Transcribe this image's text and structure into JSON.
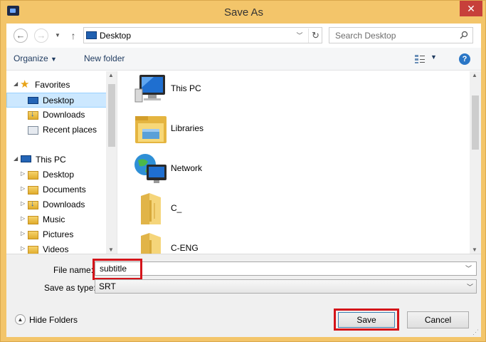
{
  "window": {
    "title": "Save As",
    "close_glyph": "✕"
  },
  "address": {
    "location": "Desktop",
    "search_placeholder": "Search Desktop"
  },
  "toolbar": {
    "organize_label": "Organize",
    "new_folder_label": "New folder",
    "help_glyph": "?"
  },
  "nav": {
    "favorites": {
      "label": "Favorites",
      "items": [
        {
          "label": "Desktop",
          "icon": "desktop-icon",
          "selected": true
        },
        {
          "label": "Downloads",
          "icon": "downloads-icon"
        },
        {
          "label": "Recent places",
          "icon": "recent-places-icon"
        }
      ]
    },
    "this_pc": {
      "label": "This PC",
      "items": [
        {
          "label": "Desktop",
          "icon": "desktop-icon"
        },
        {
          "label": "Documents",
          "icon": "documents-icon"
        },
        {
          "label": "Downloads",
          "icon": "downloads-icon"
        },
        {
          "label": "Music",
          "icon": "music-icon"
        },
        {
          "label": "Pictures",
          "icon": "pictures-icon"
        },
        {
          "label": "Videos",
          "icon": "videos-icon"
        }
      ]
    }
  },
  "content": {
    "items": [
      {
        "label": "This PC",
        "icon": "this-pc-icon"
      },
      {
        "label": "Libraries",
        "icon": "libraries-icon"
      },
      {
        "label": "Network",
        "icon": "network-icon"
      },
      {
        "label": "C_",
        "icon": "folder-icon"
      },
      {
        "label": "C-ENG",
        "icon": "folder-icon"
      }
    ]
  },
  "form": {
    "file_name_label": "File name:",
    "file_name_value": "subtitle",
    "save_type_label": "Save as type:",
    "save_type_value": "SRT"
  },
  "footer": {
    "hide_folders_label": "Hide Folders",
    "save_label": "Save",
    "cancel_label": "Cancel"
  },
  "colors": {
    "window_frame": "#f3c56a",
    "close_button": "#c7403a",
    "selection": "#cce8ff",
    "highlight_box": "#d4141a"
  }
}
